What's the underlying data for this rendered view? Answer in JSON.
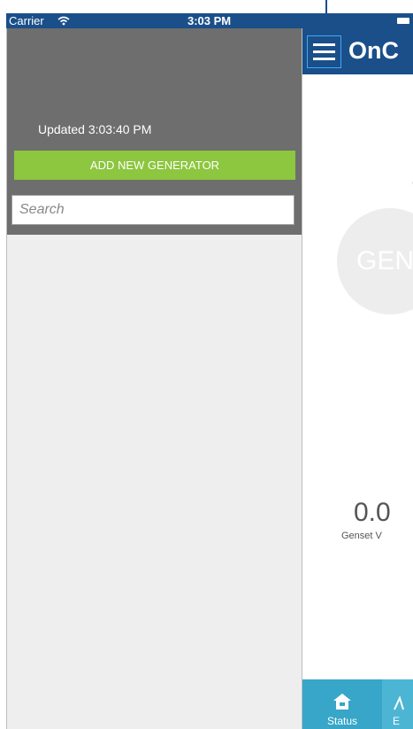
{
  "status_bar": {
    "carrier": "Carrier",
    "time": "3:03 PM"
  },
  "header": {
    "brand": "OnC"
  },
  "main": {
    "cut_letter": "C",
    "gen_circle_text": "GEN",
    "genset_value": "0.0",
    "genset_label": "Genset V"
  },
  "drawer": {
    "updated": "Updated 3:03:40 PM",
    "add_button": "ADD NEW GENERATOR",
    "search": {
      "placeholder": "Search",
      "value": ""
    }
  },
  "tabs": [
    {
      "label": "Status",
      "icon": "home-icon"
    },
    {
      "label": "E",
      "icon": "events-icon"
    }
  ],
  "colors": {
    "brand_blue": "#1a4f8a",
    "accent_green": "#8dc63f",
    "tab_blue": "#37a6c8",
    "drawer_gray": "#6e6e6e"
  }
}
